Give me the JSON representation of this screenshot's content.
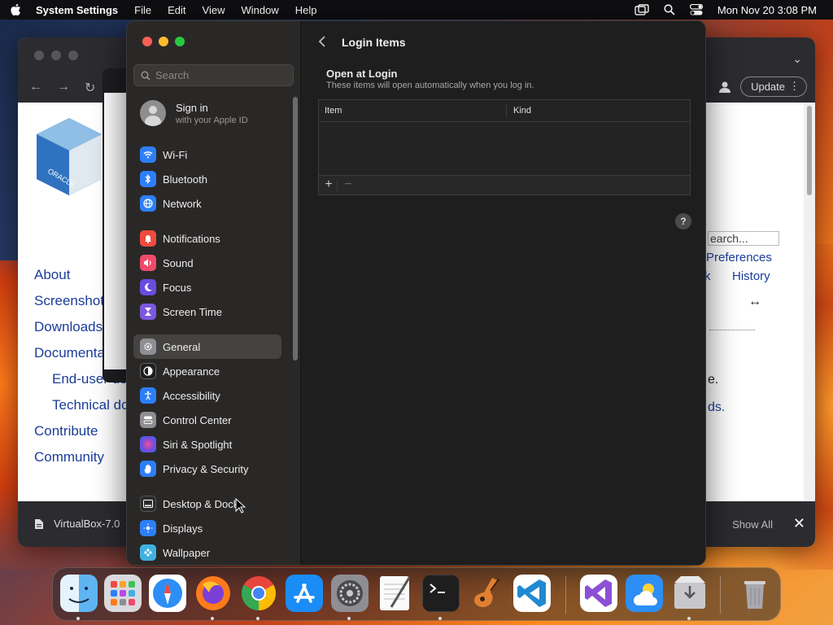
{
  "menubar": {
    "app_name": "System Settings",
    "menus": [
      "File",
      "Edit",
      "View",
      "Window",
      "Help"
    ],
    "datetime": "Mon Nov 20  3:08 PM"
  },
  "browser": {
    "update_label": "Update",
    "side_links": [
      "About",
      "Screenshots",
      "Downloads",
      "Documentation",
      "End-user docs",
      "Technical docs",
      "Contribute",
      "Community"
    ],
    "search_text": "earch...",
    "preferences_link": "Preferences",
    "history_link": "History",
    "history_prefix": "k",
    "resize_glyph": "↔",
    "partial_text_1": "e.",
    "partial_text_2": "ds.",
    "download_file": "VirtualBox-7.0",
    "show_all": "Show All"
  },
  "settings": {
    "search_placeholder": "Search",
    "signin_title": "Sign in",
    "signin_subtitle": "with your Apple ID",
    "groups": [
      [
        {
          "label": "Wi-Fi",
          "icon": "wifi-icon",
          "color": "#2d7ff9"
        },
        {
          "label": "Bluetooth",
          "icon": "bluetooth-icon",
          "color": "#2d7ff9"
        },
        {
          "label": "Network",
          "icon": "network-icon",
          "color": "#2d7ff9"
        }
      ],
      [
        {
          "label": "Notifications",
          "icon": "notifications-icon",
          "color": "#ef4a3e"
        },
        {
          "label": "Sound",
          "icon": "sound-icon",
          "color": "#ef4a6a"
        },
        {
          "label": "Focus",
          "icon": "focus-icon",
          "color": "#6a4ce0"
        },
        {
          "label": "Screen Time",
          "icon": "hourglass-icon",
          "color": "#7c58e0"
        }
      ],
      [
        {
          "label": "General",
          "icon": "gear-icon",
          "color": "#8e8e93"
        },
        {
          "label": "Appearance",
          "icon": "appearance-icon",
          "color": "#1e1e1e"
        },
        {
          "label": "Accessibility",
          "icon": "accessibility-icon",
          "color": "#2d7ff9"
        },
        {
          "label": "Control Center",
          "icon": "control-center-icon",
          "color": "#8e8e93"
        },
        {
          "label": "Siri & Spotlight",
          "icon": "siri-icon",
          "color": "#b84be0"
        },
        {
          "label": "Privacy & Security",
          "icon": "privacy-hand-icon",
          "color": "#2d7ff9"
        }
      ],
      [
        {
          "label": "Desktop & Dock",
          "icon": "desktop-dock-icon",
          "color": "#2a2a2a"
        },
        {
          "label": "Displays",
          "icon": "displays-icon",
          "color": "#2d7ff9"
        },
        {
          "label": "Wallpaper",
          "icon": "wallpaper-icon",
          "color": "#40b0e0"
        }
      ]
    ],
    "selected_item": "General",
    "page_title": "Login Items",
    "section_title": "Open at Login",
    "section_subtitle": "These items will open automatically when you log in.",
    "table_headers": {
      "item": "Item",
      "kind": "Kind"
    },
    "add_label": "+",
    "remove_label": "−",
    "help_label": "?"
  },
  "dock": {
    "apps": [
      "Finder",
      "Launchpad",
      "Safari",
      "Firefox",
      "Chrome",
      "App Store",
      "System Settings",
      "TextEdit",
      "Terminal",
      "GarageBand",
      "Visual Studio Code",
      "Visual Studio",
      "Weather",
      "Installer",
      "Trash"
    ]
  }
}
